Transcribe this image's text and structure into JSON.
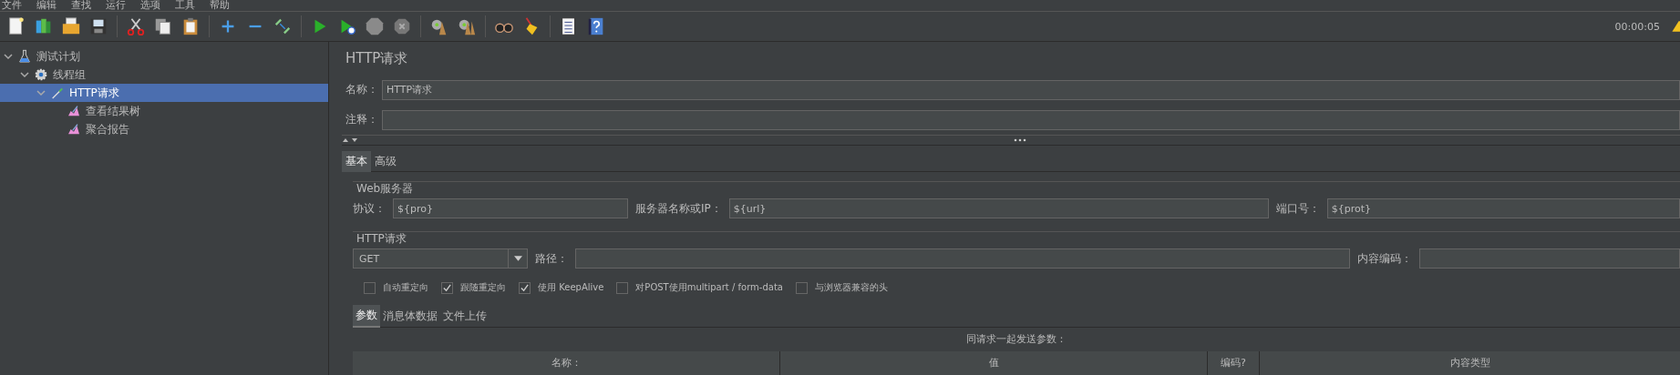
{
  "menu_bar": [
    "文件",
    "编辑",
    "查找",
    "运行",
    "选项",
    "工具",
    "帮助"
  ],
  "toolbar": {
    "elapsed_time": "00:00:05"
  },
  "tree": [
    {
      "label": "测试计划",
      "kind": "test-plan",
      "expanded": true,
      "selected": false,
      "children": [
        {
          "label": "线程组",
          "kind": "thread-group",
          "expanded": true,
          "selected": false,
          "children": [
            {
              "label": "HTTP请求",
              "kind": "sampler",
              "expanded": true,
              "selected": true,
              "children": [
                {
                  "label": "查看结果树",
                  "kind": "listener",
                  "selected": false
                },
                {
                  "label": "聚合报告",
                  "kind": "listener",
                  "selected": false
                }
              ]
            }
          ]
        }
      ]
    }
  ],
  "panel": {
    "title": "HTTP请求",
    "name_label": "名称：",
    "name_value": "HTTP请求",
    "comment_label": "注释："
  },
  "tabs": [
    {
      "label": "基本",
      "selected": true
    },
    {
      "label": "高级",
      "selected": false
    }
  ],
  "web_server": {
    "legend": "Web服务器",
    "protocol_label": "协议：",
    "protocol_value": "${pro}",
    "server_label": "服务器名称或IP：",
    "server_value": "${url}",
    "port_label": "端口号：",
    "port_value": "${prot}"
  },
  "http_request": {
    "legend": "HTTP请求",
    "method": "GET",
    "path_label": "路径：",
    "encoding_label": "内容编码："
  },
  "options": [
    {
      "label": "自动重定向",
      "checked": false
    },
    {
      "label": "跟随重定向",
      "checked": true
    },
    {
      "label": "使用 KeepAlive",
      "checked": true
    },
    {
      "label": "对POST使用multipart / form-data",
      "checked": false
    },
    {
      "label": "与浏览器兼容的头",
      "checked": false
    }
  ],
  "param_tabs": [
    {
      "label": "参数",
      "selected": true
    },
    {
      "label": "消息体数据",
      "selected": false
    },
    {
      "label": "文件上传",
      "selected": false
    }
  ],
  "parameters": {
    "caption": "同请求一起发送参数：",
    "columns": [
      "名称：",
      "值",
      "编码?",
      "内容类型"
    ]
  }
}
